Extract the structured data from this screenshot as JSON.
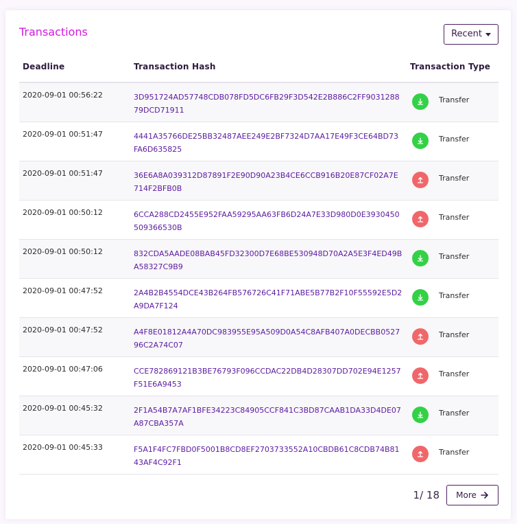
{
  "panel": {
    "title": "Transactions"
  },
  "filter": {
    "label": "Recent"
  },
  "table": {
    "headers": {
      "deadline": "Deadline",
      "hash": "Transaction Hash",
      "type": "Transaction Type"
    },
    "rows": [
      {
        "deadline": "2020-09-01 00:56:22",
        "hash": "3D951724AD57748CDB078FD5DC6FB29F3D542E2B886C2FF903128879DCD71911",
        "direction": "in",
        "icon": "download-arrow-icon",
        "type": "Transfer"
      },
      {
        "deadline": "2020-09-01 00:51:47",
        "hash": "4441A35766DE25BB32487AEE249E2BF7324D7AA17E49F3CE64BD73FA6D635825",
        "direction": "in",
        "icon": "download-arrow-icon",
        "type": "Transfer"
      },
      {
        "deadline": "2020-09-01 00:51:47",
        "hash": "36E6A8A039312D87891F2E90D90A23B4CE6CCB916B20E87CF02A7E714F2BFB0B",
        "direction": "out",
        "icon": "upload-arrow-icon",
        "type": "Transfer"
      },
      {
        "deadline": "2020-09-01 00:50:12",
        "hash": "6CCA288CD2455E952FAA59295AA63FB6D24A7E33D980D0E3930450509366530B",
        "direction": "out",
        "icon": "upload-arrow-icon",
        "type": "Transfer"
      },
      {
        "deadline": "2020-09-01 00:50:12",
        "hash": "832CDA5AADE08BAB45FD32300D7E68BE530948D70A2A5E3F4ED49BA58327C9B9",
        "direction": "in",
        "icon": "download-arrow-icon",
        "type": "Transfer"
      },
      {
        "deadline": "2020-09-01 00:47:52",
        "hash": "2A4B2B4554DCE43B264FB576726C41F71ABE5B77B2F10F55592E5D2A9DA7F124",
        "direction": "in",
        "icon": "download-arrow-icon",
        "type": "Transfer"
      },
      {
        "deadline": "2020-09-01 00:47:52",
        "hash": "A4F8E01812A4A70DC983955E95A509D0A54C8AFB407A0DECBB052796C2A74C07",
        "direction": "out",
        "icon": "upload-arrow-icon",
        "type": "Transfer"
      },
      {
        "deadline": "2020-09-01 00:47:06",
        "hash": "CCE782869121B3BE76793F096CCDAC22DB4D28307DD702E94E1257F51E6A9453",
        "direction": "out",
        "icon": "upload-arrow-icon",
        "type": "Transfer"
      },
      {
        "deadline": "2020-09-01 00:45:32",
        "hash": "2F1A54B7A7AF1BFE34223C84905CCF841C3BD87CAAB1DA33D4DE07A87CBA357A",
        "direction": "in",
        "icon": "download-arrow-icon",
        "type": "Transfer"
      },
      {
        "deadline": "2020-09-01 00:45:33",
        "hash": "F5A1F4FC7FBD0F5001B8CD8EF2703733552A10CBDB61C8CDB74B8143AF4C92F1",
        "direction": "out",
        "icon": "upload-arrow-icon",
        "type": "Transfer"
      }
    ]
  },
  "pagination": {
    "page_text": "1/ 18",
    "more_label": "More"
  },
  "colors": {
    "title": "#d319e1",
    "hash": "#5a1aa0",
    "in": "#33d146",
    "out": "#f0676a",
    "border": "#4d1f5e"
  }
}
